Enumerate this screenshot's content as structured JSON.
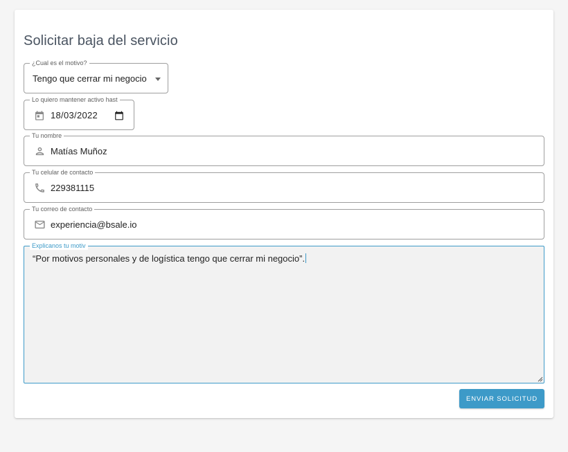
{
  "form": {
    "title": "Solicitar baja del servicio",
    "motivo": {
      "legend": "¿Cual es el motivo?",
      "value": "Tengo que cerrar mi negocio"
    },
    "fecha": {
      "legend": "Lo quiero mantener activo hast",
      "value": "18/03/2022"
    },
    "nombre": {
      "legend": "Tu nombre",
      "value": "Matías Muñoz"
    },
    "celular": {
      "legend": "Tu celular de contacto",
      "value": "229381115"
    },
    "correo": {
      "legend": "Tu correo de contacto",
      "value": "experiencia@bsale.io"
    },
    "explicacion": {
      "legend": "Explicanos tu motiv",
      "value": "“Por motivos personales y de logística tengo que cerrar mi negocio”."
    },
    "submit_label": "ENVIAR SOLICITUD"
  },
  "icons": {
    "fecha": "calendar-icon",
    "fecha_picker": "calendar-picker-icon",
    "nombre": "person-icon",
    "celular": "phone-icon",
    "correo": "mail-icon"
  },
  "colors": {
    "accent": "#3d9ac8",
    "background": "#f5f5f5",
    "card": "#ffffff",
    "textarea_bg": "#f2f2f2"
  }
}
